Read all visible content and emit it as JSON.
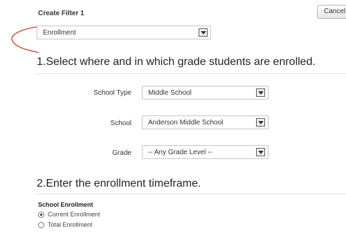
{
  "header": {
    "title": "Create Filter 1",
    "cancel_label": "Cancel"
  },
  "filter_type_select": {
    "value": "Enrollment"
  },
  "step1": {
    "heading": "1.Select where and in which grade students are enrolled.",
    "fields": [
      {
        "label": "School Type",
        "value": "Middle School"
      },
      {
        "label": "School",
        "value": "Anderson Middle School"
      },
      {
        "label": "Grade",
        "value": "-- Any Grade Level --"
      }
    ]
  },
  "step2": {
    "heading": "2.Enter the enrollment timeframe.",
    "section_label": "School Enrollment",
    "options": [
      {
        "label": "Current Enrollment",
        "checked": true
      },
      {
        "label": "Total Enrollment",
        "checked": false
      }
    ]
  },
  "colors": {
    "annotation": "#c0392b"
  }
}
